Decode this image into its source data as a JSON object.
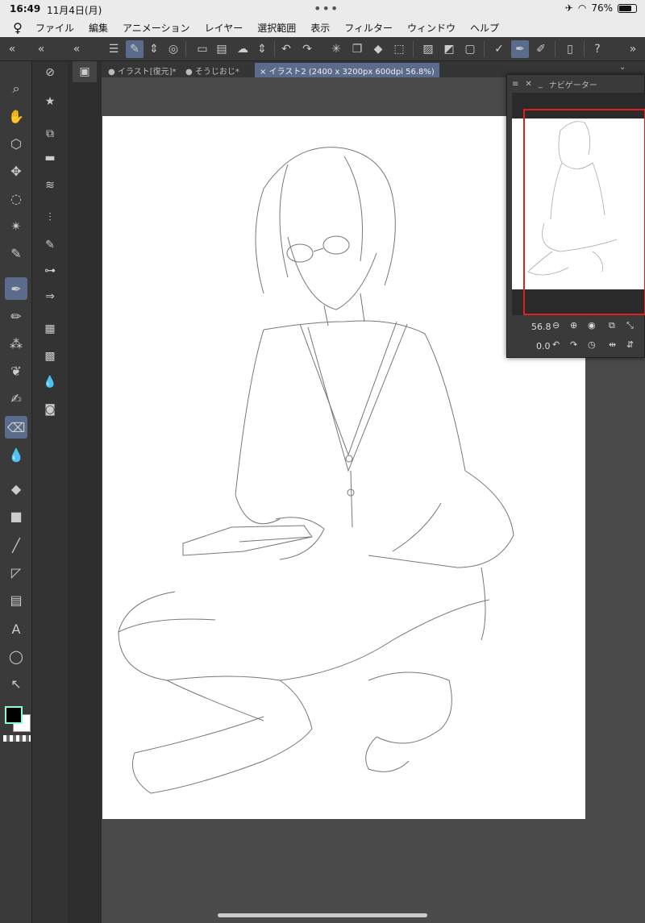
{
  "status": {
    "time": "16:49",
    "date": "11月4日(月)",
    "battery": "76%",
    "battery_level": 0.76
  },
  "menu": {
    "items": [
      "ファイル",
      "編集",
      "アニメーション",
      "レイヤー",
      "選択範囲",
      "表示",
      "フィルター",
      "ウィンドウ",
      "ヘルプ"
    ]
  },
  "tabs": [
    {
      "label": "● イラスト[復元]*"
    },
    {
      "label": "● そうじおじ*"
    },
    {
      "label": "× イラスト2 (2400 x 3200px 600dpi 56.8%)"
    }
  ],
  "navigator": {
    "title": "ナビゲーター",
    "zoom": "56.8",
    "rotation": "0.0"
  },
  "colors": {
    "accent": "#5a6b8c",
    "frame": "#e02020"
  }
}
